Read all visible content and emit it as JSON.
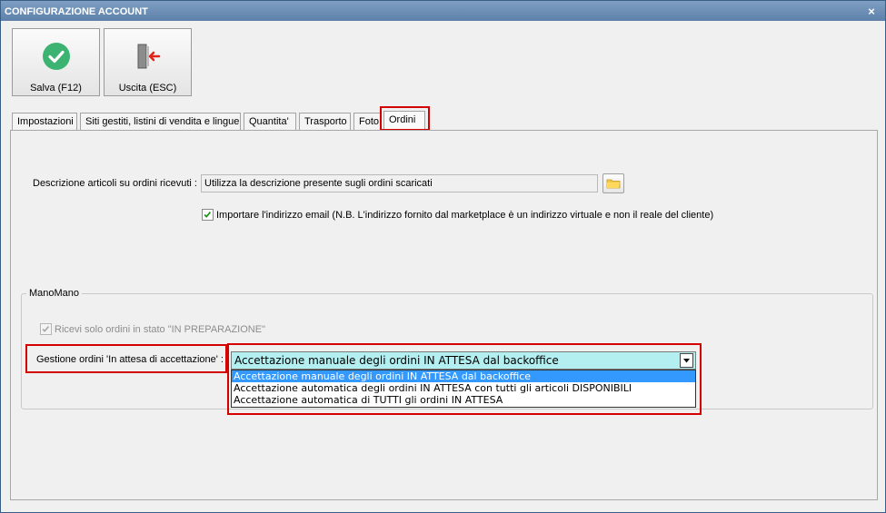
{
  "window": {
    "title": "CONFIGURAZIONE ACCOUNT",
    "close_label": "×"
  },
  "toolbar": {
    "save_label": "Salva (F12)",
    "exit_label": "Uscita (ESC)"
  },
  "tabs": [
    {
      "label": "Impostazioni"
    },
    {
      "label": "Siti gestiti, listini di vendita e lingue"
    },
    {
      "label": "Quantita'"
    },
    {
      "label": "Trasporto"
    },
    {
      "label": "Foto"
    },
    {
      "label": "Ordini",
      "active": true
    }
  ],
  "ordini": {
    "descrizione_label": "Descrizione articoli  su ordini ricevuti :",
    "descrizione_value": "Utilizza la descrizione presente sugli ordini scaricati",
    "import_email_label": "Importare l'indirizzo email (N.B. L'indirizzo fornito dal marketplace è un indirizzo virtuale e non il reale del cliente)",
    "import_email_checked": true
  },
  "manomano": {
    "group_title": "ManoMano",
    "ricevi_label": "Ricevi solo ordini in stato \"IN PREPARAZIONE\"",
    "ricevi_checked": true,
    "gestione_label": "Gestione ordini 'In attesa di accettazione' :",
    "selected_value": "Accettazione manuale degli ordini IN ATTESA dal backoffice",
    "options": [
      "Accettazione manuale degli ordini IN ATTESA dal backoffice",
      "Accettazione automatica degli ordini IN ATTESA con tutti gli articoli DISPONIBILI",
      "Accettazione automatica di TUTTI gli ordini IN ATTESA"
    ]
  },
  "colors": {
    "highlight_box": "#d40000",
    "combo_background": "#b3eef0",
    "selection": "#3399ff",
    "save_icon": "#3cb371",
    "exit_icon_arrow": "#e2231a"
  },
  "icons": {
    "save": "checkmark-circle-icon",
    "exit": "door-exit-icon",
    "browse": "folder-icon",
    "dropdown": "chevron-down-icon",
    "close": "close-icon"
  }
}
